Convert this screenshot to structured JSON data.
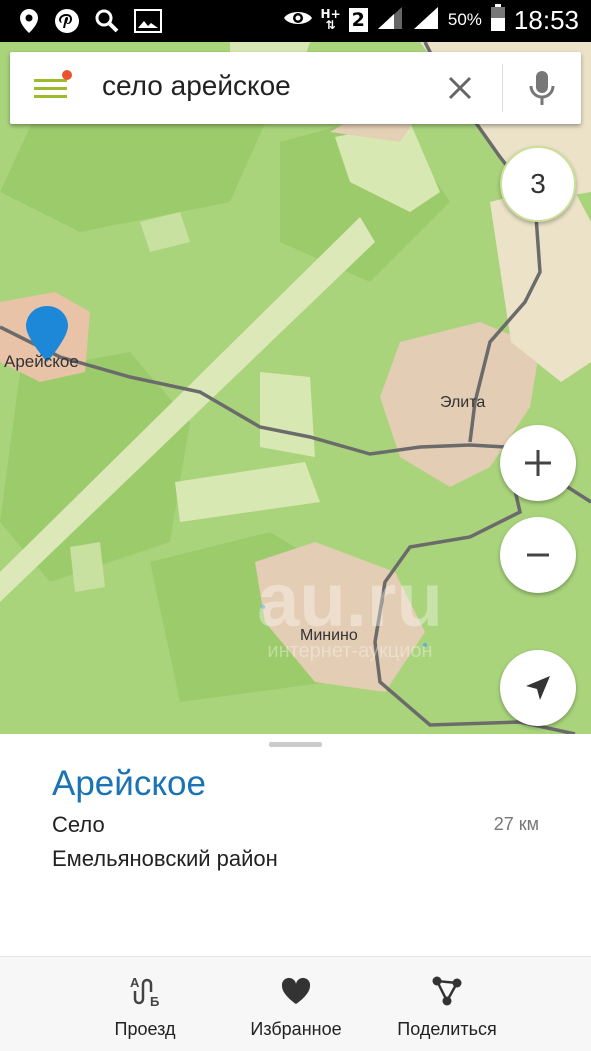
{
  "status_bar": {
    "battery_percent": "50%",
    "time": "18:53",
    "network_type": "H+",
    "sim_badge": "2",
    "icons": [
      "location-icon",
      "pinterest-icon",
      "search-icon",
      "image-icon",
      "eye-icon",
      "network-icon",
      "signal-icon",
      "signal-icon",
      "battery-icon"
    ]
  },
  "search": {
    "query": "село арейское",
    "menu_icon": "hamburger-icon",
    "clear_icon": "close-icon",
    "mic_icon": "mic-icon"
  },
  "map": {
    "zoom_level": "3",
    "labels": {
      "selected_place": "Арейское",
      "elita": "Элита",
      "minino": "Минино"
    },
    "watermark": "au.ru",
    "watermark_sub": "интернет-аукцион",
    "colors": {
      "land": "#a9d47c",
      "forest": "#8cc25a",
      "road": "#6b6b6b",
      "town": "#e4c9b0",
      "pin": "#1e88d8"
    }
  },
  "place": {
    "title": "Арейское",
    "type": "Село",
    "region": "Емельяновский район",
    "distance": "27 км"
  },
  "actions": [
    {
      "label": "Проезд",
      "icon": "route-icon"
    },
    {
      "label": "Избранное",
      "icon": "heart-icon"
    },
    {
      "label": "Поделиться",
      "icon": "share-icon"
    }
  ]
}
